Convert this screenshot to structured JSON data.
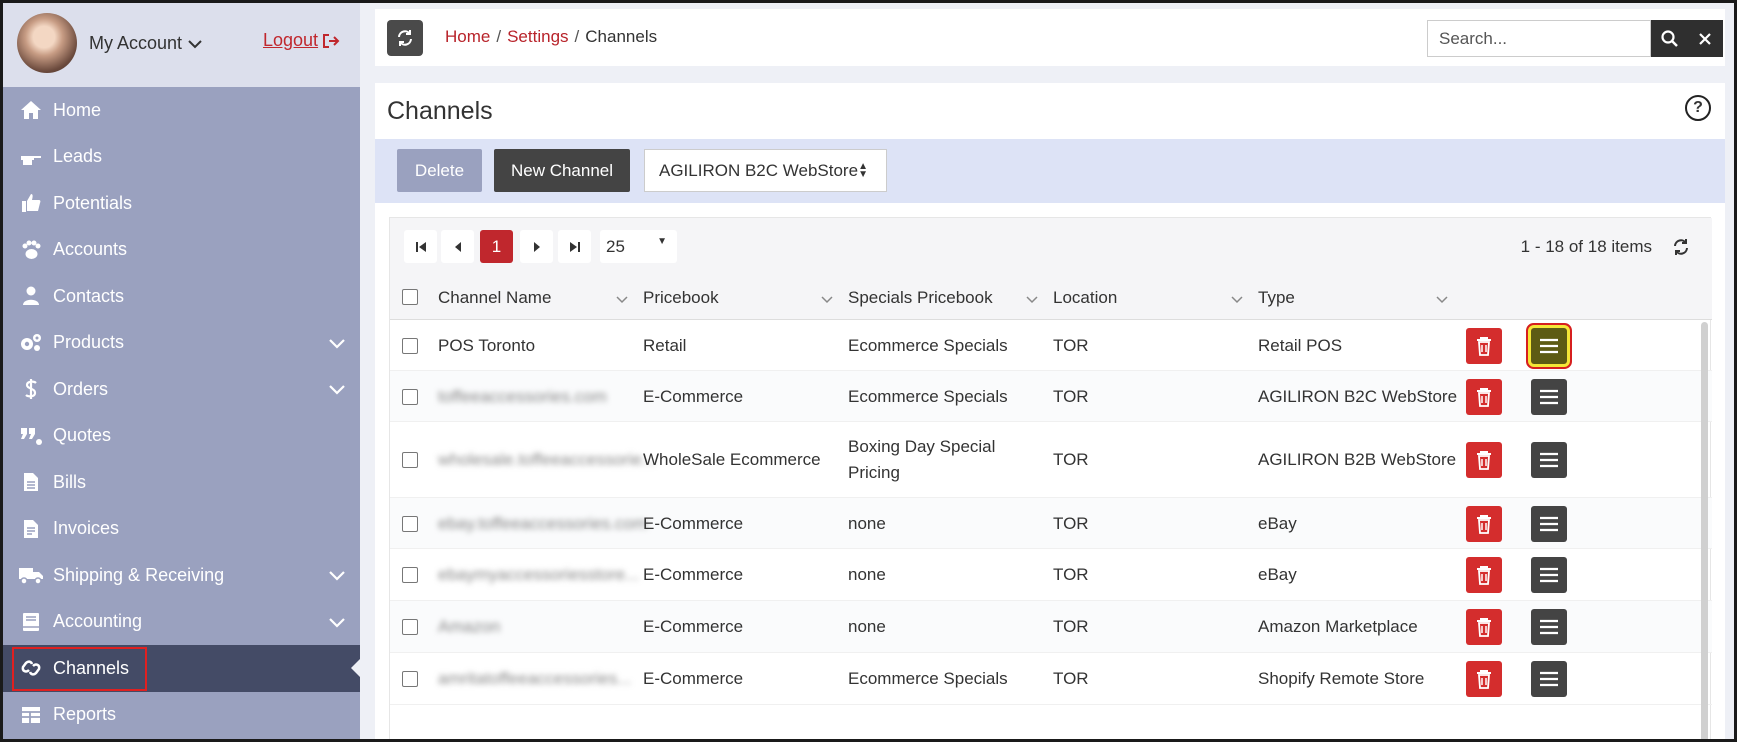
{
  "account": {
    "name": "My Account",
    "logout": "Logout"
  },
  "nav": [
    {
      "label": "Home",
      "icon": "home-icon",
      "expand": false
    },
    {
      "label": "Leads",
      "icon": "hand-point-icon",
      "expand": false
    },
    {
      "label": "Potentials",
      "icon": "thumbs-up-icon",
      "expand": false
    },
    {
      "label": "Accounts",
      "icon": "paw-icon",
      "expand": false
    },
    {
      "label": "Contacts",
      "icon": "user-icon",
      "expand": false
    },
    {
      "label": "Products",
      "icon": "gears-icon",
      "expand": true
    },
    {
      "label": "Orders",
      "icon": "dollar-icon",
      "expand": true
    },
    {
      "label": "Quotes",
      "icon": "quote-icon",
      "expand": false
    },
    {
      "label": "Bills",
      "icon": "file-icon",
      "expand": false
    },
    {
      "label": "Invoices",
      "icon": "invoice-icon",
      "expand": false
    },
    {
      "label": "Shipping & Receiving",
      "icon": "truck-icon",
      "expand": true
    },
    {
      "label": "Accounting",
      "icon": "book-icon",
      "expand": true
    },
    {
      "label": "Channels",
      "icon": "link-icon",
      "expand": false,
      "active": true
    },
    {
      "label": "Reports",
      "icon": "table-icon",
      "expand": false
    }
  ],
  "breadcrumb": {
    "home": "Home",
    "settings": "Settings",
    "current": "Channels",
    "sep": "/"
  },
  "search": {
    "placeholder": "Search...",
    "value": ""
  },
  "page": {
    "title": "Channels",
    "help": "?"
  },
  "toolbar": {
    "delete": "Delete",
    "new_channel": "New Channel",
    "store": "AGILIRON B2C WebStore"
  },
  "pager": {
    "current_page": "1",
    "page_size": "25",
    "info": "1 - 18 of 18 items"
  },
  "columns": [
    "Channel Name",
    "Pricebook",
    "Specials Pricebook",
    "Location",
    "Type"
  ],
  "rows": [
    {
      "name": "POS Toronto",
      "blurred": false,
      "pricebook": "Retail",
      "specials": "Ecommerce Specials",
      "specials2": "",
      "location": "TOR",
      "type": "Retail POS",
      "highlight": true
    },
    {
      "name": "toffeeaccessories.com",
      "blurred": true,
      "pricebook": "E-Commerce",
      "specials": "Ecommerce Specials",
      "specials2": "",
      "location": "TOR",
      "type": "AGILIRON B2C WebStore"
    },
    {
      "name": "wholesale.toffeeaccessorie...",
      "blurred": true,
      "pricebook": "WholeSale Ecommerce",
      "specials": "Boxing Day Special",
      "specials2": "Pricing",
      "location": "TOR",
      "type": "AGILIRON B2B WebStore"
    },
    {
      "name": "ebay.toffeeaccessories.com",
      "blurred": true,
      "pricebook": "E-Commerce",
      "specials": "none",
      "specials2": "",
      "location": "TOR",
      "type": "eBay"
    },
    {
      "name": "ebaymyaccessoriesstore...",
      "blurred": true,
      "pricebook": "E-Commerce",
      "specials": "none",
      "specials2": "",
      "location": "TOR",
      "type": "eBay"
    },
    {
      "name": "Amazon",
      "blurred": true,
      "pricebook": "E-Commerce",
      "specials": "none",
      "specials2": "",
      "location": "TOR",
      "type": "Amazon Marketplace"
    },
    {
      "name": "amritatoffeeaccessories...",
      "blurred": true,
      "pricebook": "E-Commerce",
      "specials": "Ecommerce Specials",
      "specials2": "",
      "location": "TOR",
      "type": "Shopify Remote Store"
    }
  ]
}
